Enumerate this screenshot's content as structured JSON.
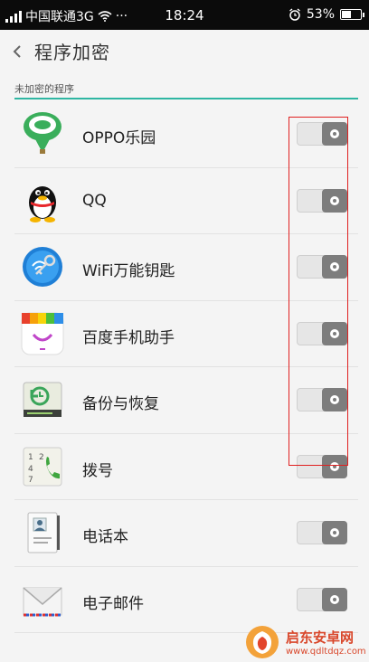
{
  "status_bar": {
    "carrier": "中国联通3G",
    "more": "···",
    "time": "18:24",
    "battery_percent": "53%",
    "battery_level": 0.53
  },
  "header": {
    "title": "程序加密"
  },
  "section": {
    "label": "未加密的程序"
  },
  "apps": [
    {
      "name": "OPPO乐园",
      "icon": "oppo-park-icon",
      "locked": false
    },
    {
      "name": "QQ",
      "icon": "qq-penguin-icon",
      "locked": false
    },
    {
      "name": "WiFi万能钥匙",
      "icon": "wifi-key-icon",
      "locked": false
    },
    {
      "name": "百度手机助手",
      "icon": "baidu-assistant-icon",
      "locked": false
    },
    {
      "name": "备份与恢复",
      "icon": "backup-restore-icon",
      "locked": false
    },
    {
      "name": "拨号",
      "icon": "dialer-icon",
      "locked": false
    },
    {
      "name": "电话本",
      "icon": "contacts-icon",
      "locked": false
    },
    {
      "name": "电子邮件",
      "icon": "email-icon",
      "locked": false
    }
  ],
  "colors": {
    "accent": "#2fb6a2",
    "highlight": "#e02020",
    "toggle_knob": "#7d7d7d"
  },
  "watermark": {
    "title": "启东安卓网",
    "url": "www.qdltdqz.com"
  }
}
